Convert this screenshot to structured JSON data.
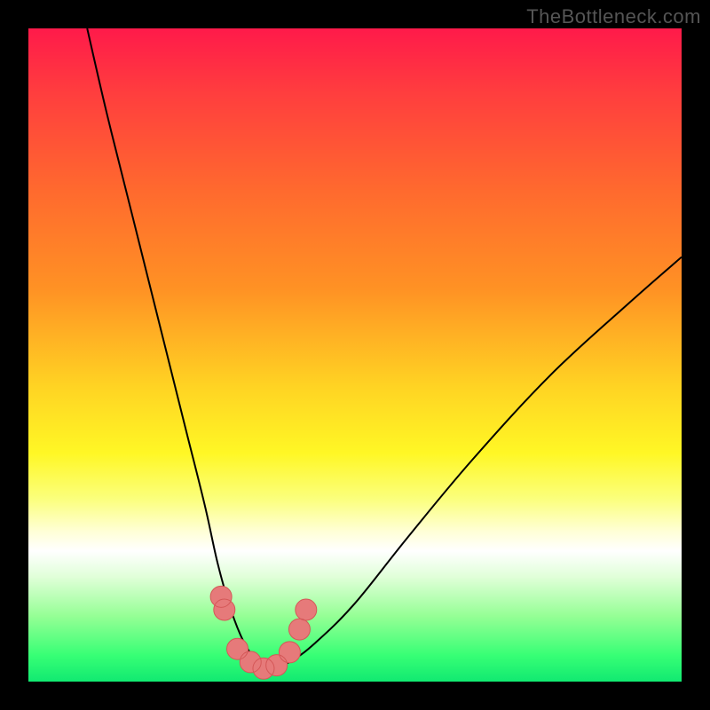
{
  "watermark": "TheBottleneck.com",
  "chart_data": {
    "type": "line",
    "title": "",
    "xlabel": "",
    "ylabel": "",
    "xlim": [
      0,
      100
    ],
    "ylim": [
      0,
      100
    ],
    "grid": false,
    "series": [
      {
        "name": "bottleneck-curve",
        "x": [
          9,
          12,
          16,
          20,
          24,
          27,
          29,
          31,
          33,
          35,
          36,
          37,
          40,
          44,
          50,
          58,
          68,
          80,
          92,
          100
        ],
        "values": [
          100,
          87,
          71,
          55,
          39,
          27,
          18,
          11,
          6,
          3,
          2,
          2,
          3,
          6,
          12,
          22,
          34,
          47,
          58,
          65
        ]
      }
    ],
    "markers": {
      "name": "highlight-cluster",
      "x": [
        29.5,
        30,
        32,
        34,
        36,
        38,
        40,
        41.5,
        42.5
      ],
      "values": [
        13,
        11,
        5,
        3,
        2,
        2.5,
        4.5,
        8,
        11
      ]
    },
    "background_gradient": {
      "stops": [
        {
          "pos": 0.0,
          "color": "#ff1a4a"
        },
        {
          "pos": 0.1,
          "color": "#ff3e3e"
        },
        {
          "pos": 0.25,
          "color": "#ff6a2e"
        },
        {
          "pos": 0.4,
          "color": "#ff9224"
        },
        {
          "pos": 0.55,
          "color": "#ffd423"
        },
        {
          "pos": 0.65,
          "color": "#fff725"
        },
        {
          "pos": 0.72,
          "color": "#fbff7c"
        },
        {
          "pos": 0.77,
          "color": "#ffffd6"
        },
        {
          "pos": 0.8,
          "color": "#ffffff"
        },
        {
          "pos": 0.84,
          "color": "#e0ffd8"
        },
        {
          "pos": 0.9,
          "color": "#95ff95"
        },
        {
          "pos": 0.96,
          "color": "#37ff75"
        },
        {
          "pos": 1.0,
          "color": "#11e971"
        }
      ]
    }
  }
}
